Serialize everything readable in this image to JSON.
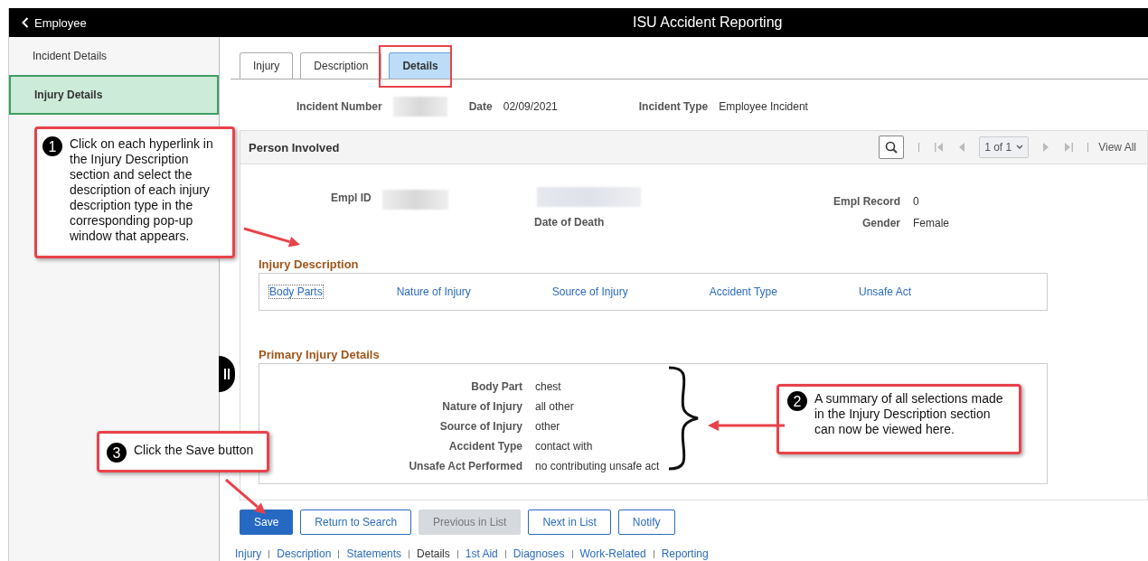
{
  "header": {
    "back_label": "Employee",
    "title": "ISU Accident Reporting"
  },
  "sidebar": {
    "items": [
      {
        "label": "Incident Details",
        "selected": false
      },
      {
        "label": "Injury Details",
        "selected": true
      }
    ]
  },
  "tabs": [
    {
      "label": "Injury",
      "selected": false
    },
    {
      "label": "Description",
      "selected": false
    },
    {
      "label": "Details",
      "selected": true
    }
  ],
  "summary": [
    {
      "label": "Incident Number",
      "kind": "blurred"
    },
    {
      "label": "Date",
      "kind": "text",
      "value": "02/09/2021"
    },
    {
      "label": "Incident Type",
      "kind": "text",
      "value": "Employee Incident"
    }
  ],
  "person_involved": {
    "title": "Person Involved",
    "pager": "1 of 1",
    "view_all": "View All",
    "empl_id_label": "Empl ID",
    "date_of_death_label": "Date of Death",
    "empl_record_label": "Empl Record",
    "empl_record": "0",
    "gender_label": "Gender",
    "gender": "Female"
  },
  "injury_description": {
    "title": "Injury Description",
    "links": [
      "Body Parts",
      "Nature of Injury",
      "Source of Injury",
      "Accident Type",
      "Unsafe Act"
    ]
  },
  "primary_injury_details": {
    "title": "Primary Injury Details",
    "rows": [
      {
        "label": "Body Part",
        "value": "chest"
      },
      {
        "label": "Nature of Injury",
        "value": "all other"
      },
      {
        "label": "Source of Injury",
        "value": "other"
      },
      {
        "label": "Accident Type",
        "value": "contact with"
      },
      {
        "label": "Unsafe Act Performed",
        "value": "no contributing unsafe act"
      }
    ]
  },
  "buttons": [
    {
      "label": "Save",
      "kind": "primary",
      "disabled": false
    },
    {
      "label": "Return to Search",
      "kind": "secondary",
      "disabled": false
    },
    {
      "label": "Previous in List",
      "kind": "secondary",
      "disabled": true
    },
    {
      "label": "Next in List",
      "kind": "secondary",
      "disabled": false
    },
    {
      "label": "Notify",
      "kind": "secondary",
      "disabled": false
    }
  ],
  "page_links": [
    {
      "label": "Injury",
      "selected": false
    },
    {
      "label": "Description",
      "selected": false
    },
    {
      "label": "Statements",
      "selected": false
    },
    {
      "label": "Details",
      "selected": true
    },
    {
      "label": "1st Aid",
      "selected": false
    },
    {
      "label": "Diagnoses",
      "selected": false
    },
    {
      "label": "Work-Related",
      "selected": false
    },
    {
      "label": "Reporting",
      "selected": false
    }
  ],
  "callouts": [
    {
      "number": "1",
      "text": "Click on each hyperlink in the Injury Description section and select the description of each injury description type in the corresponding pop-up window that appears."
    },
    {
      "number": "2",
      "text": "A summary of all selections made in the Injury Description section can now be viewed here."
    },
    {
      "number": "3",
      "text": "Click the Save button"
    }
  ]
}
